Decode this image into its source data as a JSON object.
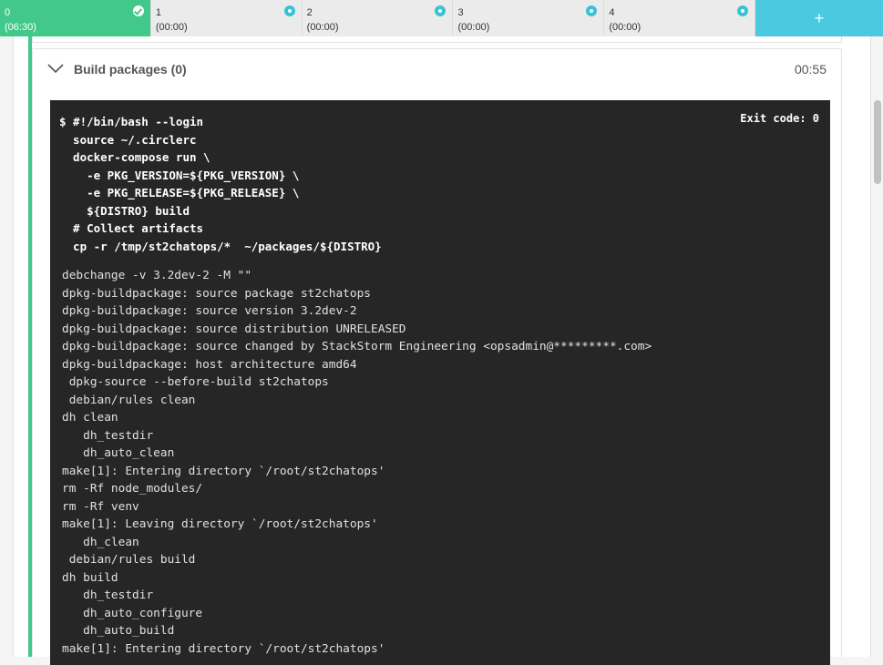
{
  "tabs": [
    {
      "num": "0",
      "time": "(06:30)",
      "status": "success"
    },
    {
      "num": "1",
      "time": "(00:00)",
      "status": "queued"
    },
    {
      "num": "2",
      "time": "(00:00)",
      "status": "queued"
    },
    {
      "num": "3",
      "time": "(00:00)",
      "status": "queued"
    },
    {
      "num": "4",
      "time": "(00:00)",
      "status": "queued"
    }
  ],
  "add_tab_label": "+",
  "step": {
    "title": "Build packages (0)",
    "duration": "00:55",
    "exit_code": "Exit code: 0",
    "command": "$ #!/bin/bash --login\n  source ~/.circlerc\n  docker-compose run \\\n    -e PKG_VERSION=${PKG_VERSION} \\\n    -e PKG_RELEASE=${PKG_RELEASE} \\\n    ${DISTRO} build\n  # Collect artifacts\n  cp -r /tmp/st2chatops/*  ~/packages/${DISTRO}",
    "output": "debchange -v 3.2dev-2 -M \"\"\ndpkg-buildpackage: source package st2chatops\ndpkg-buildpackage: source version 3.2dev-2\ndpkg-buildpackage: source distribution UNRELEASED\ndpkg-buildpackage: source changed by StackStorm Engineering <opsadmin@*********.com>\ndpkg-buildpackage: host architecture amd64\n dpkg-source --before-build st2chatops\n debian/rules clean\ndh clean\n   dh_testdir\n   dh_auto_clean\nmake[1]: Entering directory `/root/st2chatops'\nrm -Rf node_modules/\nrm -Rf venv\nmake[1]: Leaving directory `/root/st2chatops'\n   dh_clean\n debian/rules build\ndh build\n   dh_testdir\n   dh_auto_configure\n   dh_auto_build\nmake[1]: Entering directory `/root/st2chatops'"
  },
  "colors": {
    "success": "#42c88a",
    "queued": "#39c2d7",
    "terminal_bg": "#262626"
  }
}
